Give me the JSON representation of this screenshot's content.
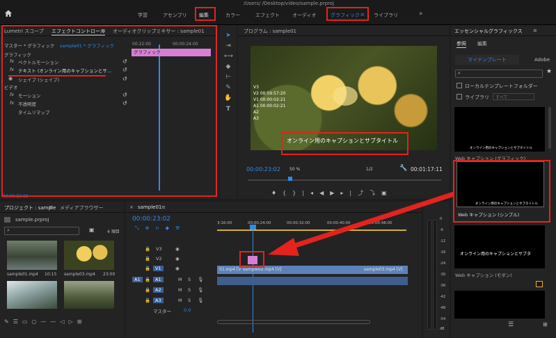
{
  "title_bar": {
    "path": "/Users/          /Desktop/video/sample.prproj"
  },
  "workspaces": [
    "学習",
    "アセンブリ",
    "編集",
    "カラー",
    "エフェクト",
    "オーディオ",
    "グラフィック",
    "ライブラリ",
    "≡",
    "»"
  ],
  "effect_panel": {
    "tabs": [
      "Lumetri スコープ",
      "エフェクトコントロール",
      "≡",
      "オーディオクリップミキサー : sample01"
    ],
    "master_label": "マスター * グラフィック",
    "clip_label": "sample01 * グラフィック",
    "timecodes": [
      "00:22:00",
      "00:00:24:00"
    ],
    "graphic_bar": "グラフィック",
    "rows": [
      "グラフィック",
      "ベクトルモーション",
      "テキスト (オンライン用のキャプションとサ...",
      "シェイプ (シェイプ)",
      "ビデオ",
      "モーション",
      "不透明度",
      "タイムリマップ"
    ],
    "fx": "fx",
    "footer_time": "00:00:23:02"
  },
  "program": {
    "title": "プログラム : sample01",
    "overlay": [
      "V3",
      "V2 00:59:57:20",
      "V1 00:00:02:21",
      "A1 00:00:02:21",
      "A2",
      "A3"
    ],
    "caption": "オンライン用のキャプションとサブタイトル",
    "timecode": "00:00:23:02",
    "zoom": "50 %",
    "resolution": "1/2",
    "duration": "00:01:17:11"
  },
  "essential": {
    "title": "エッセンシャルグラフィックス",
    "menu": "≡",
    "tabs": [
      "参照",
      "編集"
    ],
    "my_templates": "マイテンプレート",
    "adobe": "Adobe",
    "local_folder": "ローカルテンプレートフォルダー",
    "library": "ライブラリ",
    "library_value": "すべて",
    "items": [
      {
        "thumb_text": "オンライン用のキャプションとサブタイトル",
        "label": "Web キャプション (グラフィック)"
      },
      {
        "thumb_text": "オンライン用のキャプションとサブタイトル",
        "label": "Web キャプション (シンプル)"
      },
      {
        "thumb_text": "オンライン用のキャプションとサブタ",
        "label": "Web キャプション (モダン)"
      }
    ]
  },
  "project": {
    "tabs": [
      "プロジェクト : sample",
      "≡",
      "メディアブラウザー"
    ],
    "file": "sample.prproj",
    "count": "4 項目",
    "clips": [
      {
        "name": "sample01.mp4",
        "dur": "10:15"
      },
      {
        "name": "sample03.mp4",
        "dur": "23:00"
      },
      {
        "name": "",
        "dur": ""
      },
      {
        "name": "",
        "dur": ""
      }
    ]
  },
  "timeline": {
    "tab": "sample01",
    "menu": "≡",
    "timecode": "00:00:23:02",
    "ruler": [
      "3:16:00",
      "00:00:24:00",
      "00:00:32:00",
      "00:00:40:00",
      "00:00:48:00"
    ],
    "video_tracks": [
      "V3",
      "V2",
      "V1"
    ],
    "audio_tracks": [
      "A1",
      "A2",
      "A3"
    ],
    "master": "マスター",
    "master_value": "0.0",
    "clips": {
      "v1a": "01.mp4 [V]",
      "v1b": "sample02.mp4 [V]",
      "v1c": "sample03.mp4 [V]"
    },
    "m": "M",
    "s": "S"
  },
  "meter": [
    "0",
    "-6",
    "-12",
    "-18",
    "-24",
    "-30",
    "-36",
    "-42",
    "-48",
    "-54",
    "dB"
  ],
  "colors": {
    "accent": "#2d8ceb",
    "highlight": "#e3231d",
    "graphic_clip": "#d77fd5",
    "video_clip": "#5d82b8"
  }
}
